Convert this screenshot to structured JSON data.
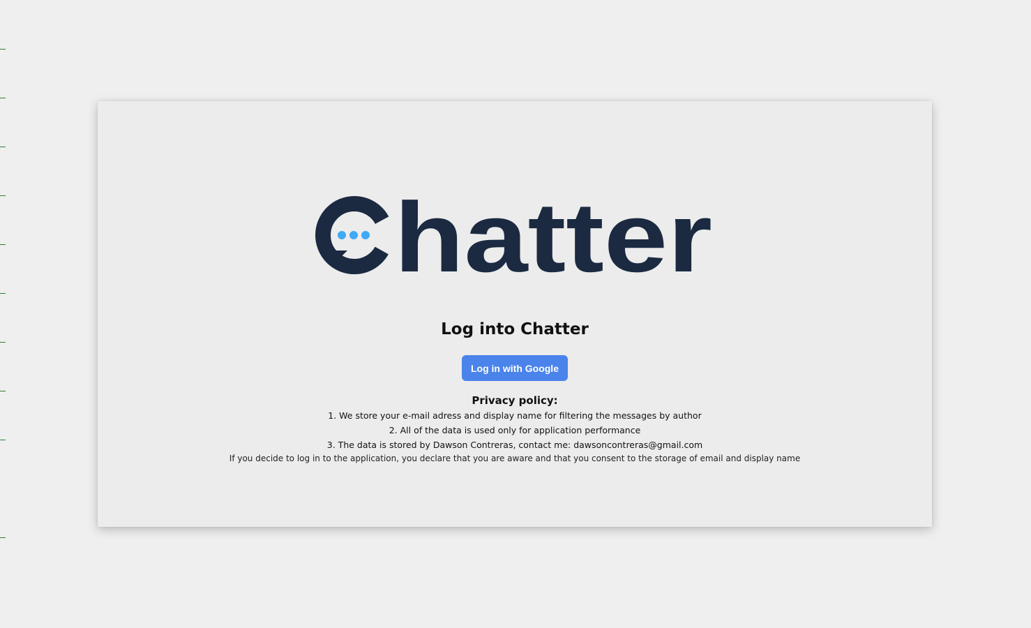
{
  "logo": {
    "text": "Chatter",
    "icon": "speech-bubble-icon",
    "colors": {
      "wordmark": "#1b2a41",
      "dots": "#3fa9f5"
    }
  },
  "login": {
    "heading": "Log into Chatter",
    "google_button_label": "Log in with Google",
    "button_color": "#4a83ea"
  },
  "privacy": {
    "title": "Privacy policy:",
    "items": [
      "1. We store your e-mail adress and display name for filtering the messages by author",
      "2. All of the data is used only for application performance",
      "3. The data is stored by Dawson Contreras, contact me: dawsoncontreras@gmail.com"
    ],
    "consent_note": "If you decide to log in to the application, you declare that you are aware and that you consent to the storage of email and display name"
  }
}
